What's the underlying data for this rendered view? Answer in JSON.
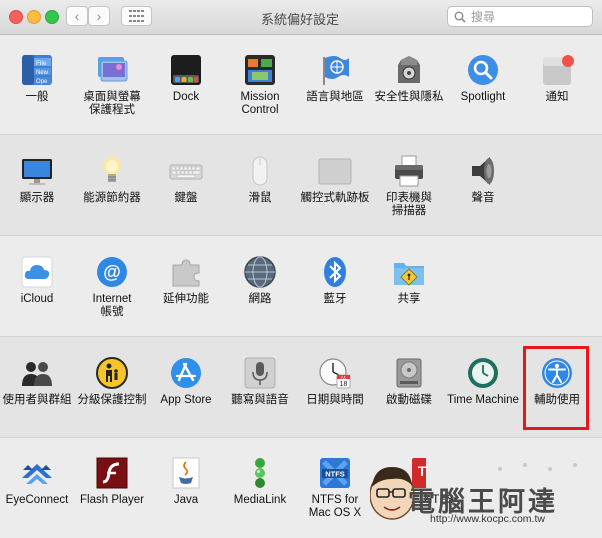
{
  "window": {
    "title": "系統偏好設定",
    "search_placeholder": "搜尋"
  },
  "rows": [
    [
      {
        "label": "一般",
        "icon": "general-icon"
      },
      {
        "label": "桌面與螢幕\n保護程式",
        "icon": "desktop-screensaver-icon"
      },
      {
        "label": "Dock",
        "icon": "dock-icon"
      },
      {
        "label": "Mission\nControl",
        "icon": "mission-control-icon"
      },
      {
        "label": "語言與地區",
        "icon": "language-region-icon"
      },
      {
        "label": "安全性與隱私",
        "icon": "security-privacy-icon"
      },
      {
        "label": "Spotlight",
        "icon": "spotlight-icon"
      },
      {
        "label": "通知",
        "icon": "notifications-icon"
      }
    ],
    [
      {
        "label": "顯示器",
        "icon": "displays-icon"
      },
      {
        "label": "能源節約器",
        "icon": "energy-saver-icon"
      },
      {
        "label": "鍵盤",
        "icon": "keyboard-icon"
      },
      {
        "label": "滑鼠",
        "icon": "mouse-icon"
      },
      {
        "label": "觸控式軌跡板",
        "icon": "trackpad-icon"
      },
      {
        "label": "印表機與\n掃描器",
        "icon": "printers-scanners-icon"
      },
      {
        "label": "聲音",
        "icon": "sound-icon"
      }
    ],
    [
      {
        "label": "iCloud",
        "icon": "icloud-icon"
      },
      {
        "label": "Internet\n帳號",
        "icon": "internet-accounts-icon"
      },
      {
        "label": "延伸功能",
        "icon": "extensions-icon"
      },
      {
        "label": "網路",
        "icon": "network-icon"
      },
      {
        "label": "藍牙",
        "icon": "bluetooth-icon"
      },
      {
        "label": "共享",
        "icon": "sharing-icon"
      }
    ],
    [
      {
        "label": "使用者與群組",
        "icon": "users-groups-icon"
      },
      {
        "label": "分級保護控制",
        "icon": "parental-controls-icon"
      },
      {
        "label": "App Store",
        "icon": "app-store-icon"
      },
      {
        "label": "聽寫與語音",
        "icon": "dictation-speech-icon"
      },
      {
        "label": "日期與時間",
        "icon": "date-time-icon"
      },
      {
        "label": "啟動磁碟",
        "icon": "startup-disk-icon"
      },
      {
        "label": "Time Machine",
        "icon": "time-machine-icon"
      },
      {
        "label": "輔助使用",
        "icon": "accessibility-icon"
      }
    ],
    [
      {
        "label": "EyeConnect",
        "icon": "eyeconnect-icon"
      },
      {
        "label": "Flash Player",
        "icon": "flash-player-icon"
      },
      {
        "label": "Java",
        "icon": "java-icon"
      },
      {
        "label": "MediaLink",
        "icon": "medialink-icon"
      },
      {
        "label": "NTFS for\nMac OS X",
        "icon": "ntfs-icon"
      },
      {
        "label": "NTFS",
        "icon": "ntfs-3g-icon"
      }
    ]
  ],
  "icon_text": {
    "file": "File",
    "new": "New",
    "ope": "Ope",
    "ntfs": "NTFS",
    "cal_month": "JUL",
    "cal_day": "18"
  },
  "watermark": {
    "title": "電腦王阿達",
    "url": "http://www.kocpc.com.tw"
  }
}
